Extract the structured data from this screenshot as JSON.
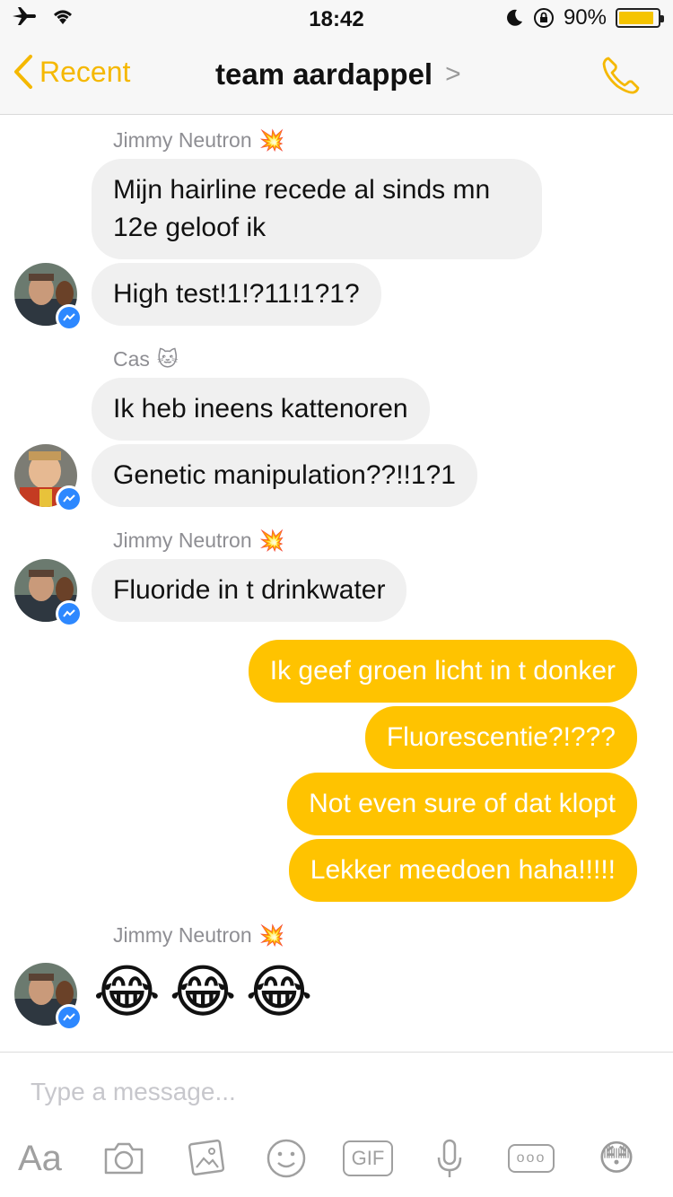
{
  "status_bar": {
    "time": "18:42",
    "battery_text": "90%",
    "battery_level": 0.9,
    "icons": [
      "airplane-icon",
      "wifi-icon",
      "moon-icon",
      "orientation-lock-icon",
      "battery-icon"
    ]
  },
  "nav": {
    "back_label": "Recent",
    "title": "team aardappel",
    "title_chevron": ">",
    "accent_color": "#f5b800",
    "call_icon": "phone-icon"
  },
  "messages": {
    "g1": {
      "sender": "Jimmy Neutron",
      "sender_emoji": "💥",
      "m1": "Mijn hairline recede al sinds mn",
      "m1b": "12e geloof ik",
      "m2": "High test!1!?11!1?1?"
    },
    "g2": {
      "sender": "Cas",
      "sender_emoji": "🐱",
      "m1": "Ik heb ineens kattenoren",
      "m2": "Genetic manipulation??!!1?1"
    },
    "g3": {
      "sender": "Jimmy Neutron",
      "sender_emoji": "💥",
      "m1": "Fluoride in t drinkwater"
    },
    "outgoing": {
      "m1": "Ik geef groen licht in t donker",
      "m2": "Fluorescentie?!???",
      "m3": "Not even sure of dat klopt",
      "m4": "Lekker meedoen haha!!!!!"
    },
    "g4": {
      "sender": "Jimmy Neutron",
      "sender_emoji": "💥",
      "emoji": [
        "😂",
        "😂",
        "😂"
      ]
    }
  },
  "colors": {
    "outgoing_bubble": "#ffc300",
    "incoming_bubble": "#f0f0f0",
    "messenger_badge": "#2d88ff"
  },
  "composer": {
    "placeholder": "Type a message...",
    "aa_label": "Aa",
    "gif_label": "GIF",
    "more_label": "ooo",
    "emoji_label": "😳",
    "icons": [
      "camera-icon",
      "gallery-icon",
      "sticker-icon",
      "microphone-icon"
    ]
  }
}
